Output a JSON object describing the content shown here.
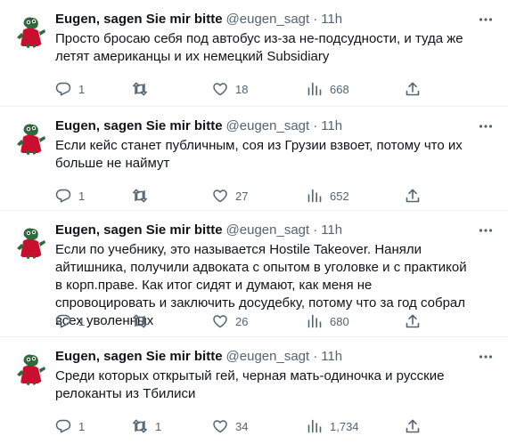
{
  "tweets": [
    {
      "name": "Eugen, sagen Sie mir bitte",
      "handle": "@eugen_sagt",
      "dot": "·",
      "time": "11h",
      "text": "Просто бросаю себя под автобус из-за не-подсудности, и туда же летят американцы и их немецкий Subsidiary",
      "replies": "1",
      "retweets": "",
      "likes": "18",
      "views": "668"
    },
    {
      "name": "Eugen, sagen Sie mir bitte",
      "handle": "@eugen_sagt",
      "dot": "·",
      "time": "11h",
      "text": "Если кейс станет публичным, соя из Грузии взвоет, потому что их больше не наймут",
      "replies": "1",
      "retweets": "",
      "likes": "27",
      "views": "652"
    },
    {
      "name": "Eugen, sagen Sie mir bitte",
      "handle": "@eugen_sagt",
      "dot": "·",
      "time": "11h",
      "text": "Если по учебнику, это называется Hostile Takeover. Наняли айтишника, получили адвоката с опытом в уголовке и с практикой в корп.праве. Как итог сидят и думают, как меня не спровоцировать и заключить досудебку, потому что за год собрал всех уволенных",
      "replies": "1",
      "retweets": "",
      "likes": "26",
      "views": "680"
    },
    {
      "name": "Eugen, sagen Sie mir bitte",
      "handle": "@eugen_sagt",
      "dot": "·",
      "time": "11h",
      "text": "Среди которых открытый гей, черная мать-одиночка и русские релоканты из Тбилиси",
      "replies": "1",
      "retweets": "1",
      "likes": "34",
      "views": "1,734"
    }
  ],
  "icons": {
    "more": "more-horizontal-icon",
    "reply": "reply-icon",
    "retweet": "retweet-icon",
    "like": "heart-icon",
    "views": "views-chart-icon",
    "share": "share-icon"
  },
  "colors": {
    "text": "#0f1419",
    "secondary": "#536471",
    "divider": "#eff3f4",
    "avatar_red": "#c8102e",
    "avatar_green": "#2e6b3a"
  }
}
